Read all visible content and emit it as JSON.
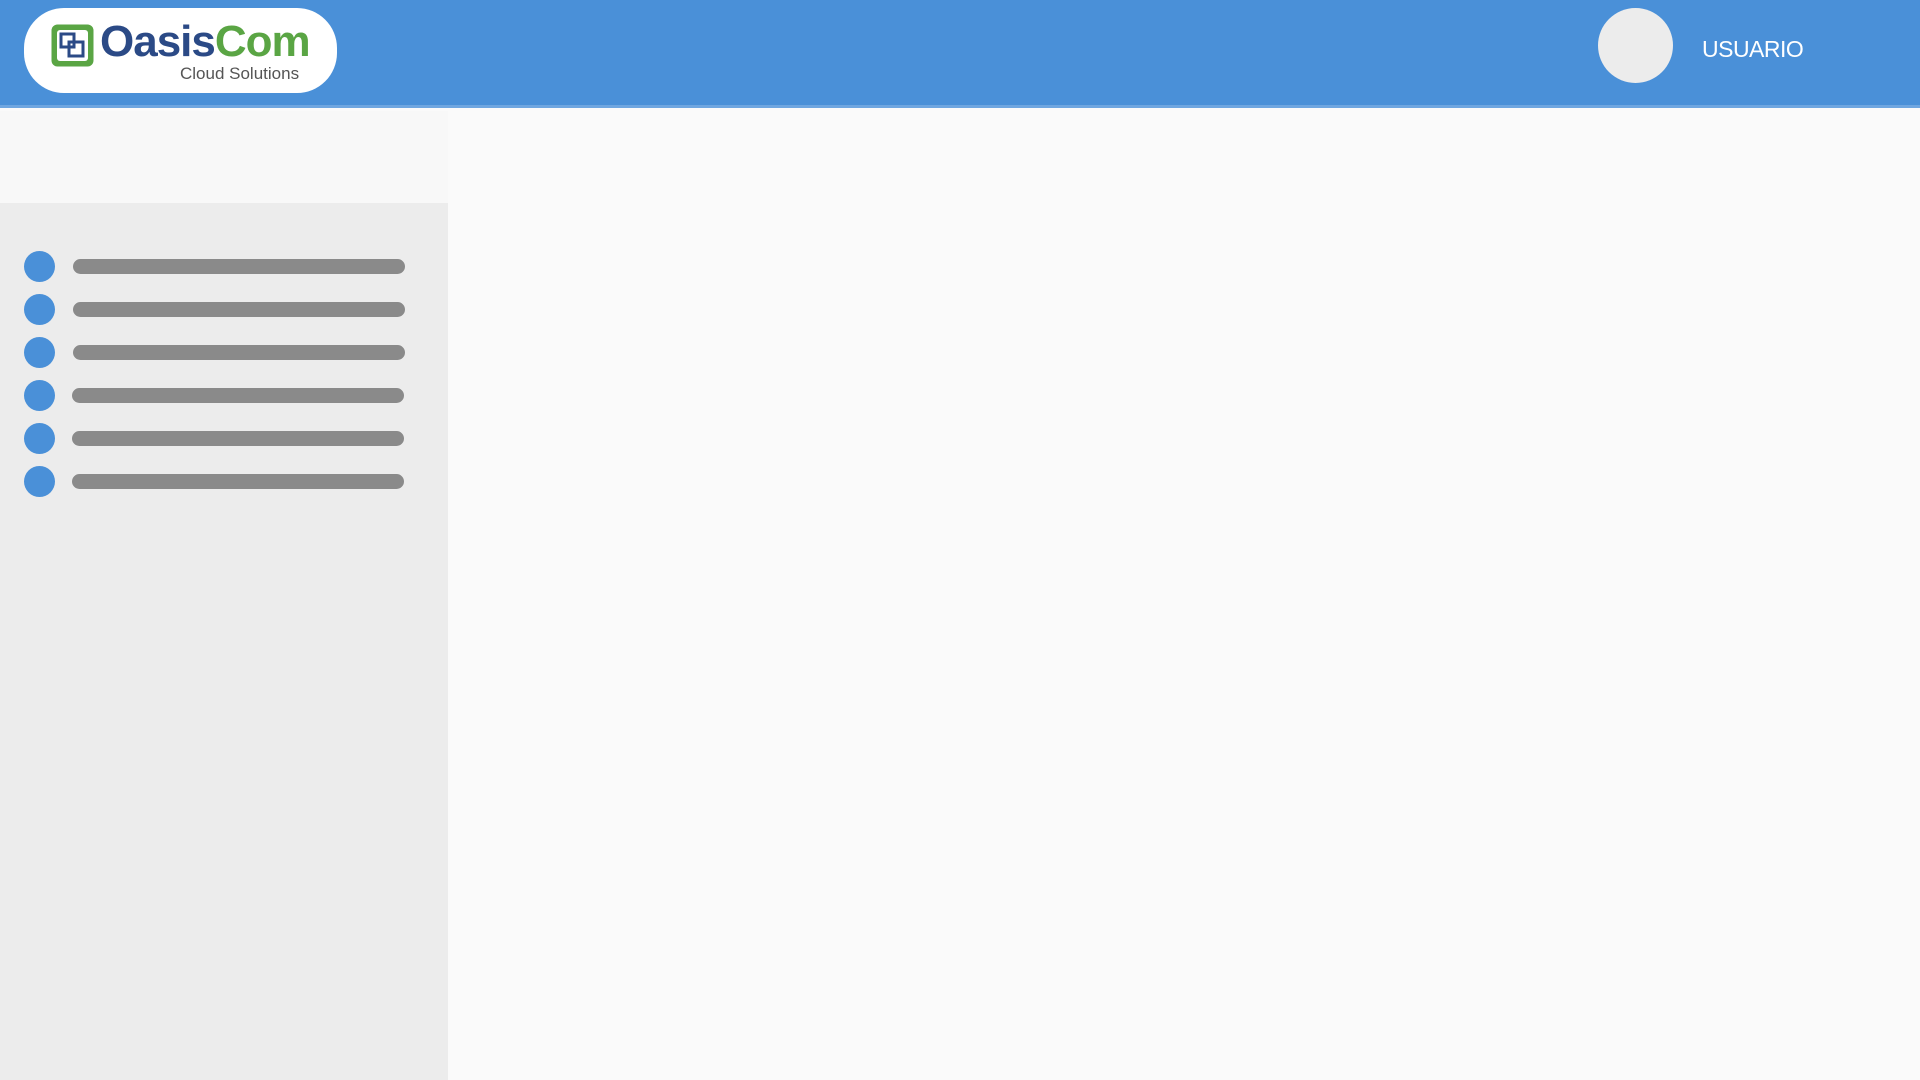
{
  "header": {
    "brand": {
      "name_part1": "Oasis",
      "name_part2": "Com",
      "tagline": "Cloud Solutions",
      "colors": {
        "dark_blue": "#2b4a86",
        "green": "#5aa544"
      }
    },
    "user": {
      "label": "USUARIO",
      "avatar_icon": "user-avatar-placeholder"
    },
    "background_color": "#4a90d8"
  },
  "sidebar": {
    "items": [
      {
        "icon": "bullet-dot-icon",
        "label": ""
      },
      {
        "icon": "bullet-dot-icon",
        "label": ""
      },
      {
        "icon": "bullet-dot-icon",
        "label": ""
      },
      {
        "icon": "bullet-dot-icon",
        "label": ""
      },
      {
        "icon": "bullet-dot-icon",
        "label": ""
      },
      {
        "icon": "bullet-dot-icon",
        "label": ""
      }
    ],
    "accent_color": "#4a90d8",
    "placeholder_bar_color": "#8a8a8a"
  }
}
